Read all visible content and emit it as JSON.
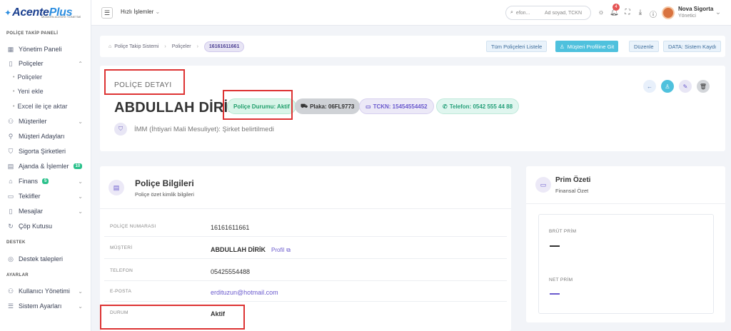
{
  "app": {
    "logo_main": "Acente",
    "logo_accent": "Plus",
    "logo_sub": "MODERN ACENTE YÖNETİMİ"
  },
  "sidebar": {
    "section_main": "POLİÇE TAKİP PANELİ",
    "items": [
      {
        "label": "Yönetim Paneli",
        "icon": "grid-icon"
      },
      {
        "label": "Poliçeler",
        "icon": "document-icon"
      },
      {
        "label": "Poliçeler",
        "icon": "dot"
      },
      {
        "label": "Yeni ekle",
        "icon": "dot"
      },
      {
        "label": "Excel ile içe aktar",
        "icon": "dot"
      },
      {
        "label": "Müşteriler",
        "icon": "users-icon"
      },
      {
        "label": "Müşteri Adayları",
        "icon": "user-plus-icon"
      },
      {
        "label": "Sigorta Şirketleri",
        "icon": "shield-icon"
      },
      {
        "label": "Ajanda & İşlemler",
        "icon": "calendar-icon",
        "badge": "10"
      },
      {
        "label": "Finans",
        "icon": "bank-icon",
        "badge": "5"
      },
      {
        "label": "Teklifler",
        "icon": "file-icon"
      },
      {
        "label": "Mesajlar",
        "icon": "phone-icon"
      },
      {
        "label": "Çöp Kutusu",
        "icon": "refresh-icon"
      }
    ],
    "section_support": "DESTEK",
    "support_item": "Destek talepleri",
    "section_settings": "AYARLAR",
    "settings_items": [
      "Kullanıcı Yönetimi",
      "Sistem Ayarları"
    ]
  },
  "topbar": {
    "quick": "Hızlı İşlemler",
    "search_placeholder": "efon...",
    "search_placeholder2": "Ad soyad, TCKN",
    "notif_count": "4",
    "user_name": "Nova Sigorta",
    "user_role": "Yönetici"
  },
  "breadcrumb": {
    "home": "Poliçe Takip Sistemi",
    "mid": "Poliçeler",
    "current": "16161611661"
  },
  "actions": {
    "list_all": "Tüm Poliçeleri Listele",
    "customer_profile": "Müşteri Profiline Git",
    "edit": "Düzenle",
    "data_source": "DATA: Sistem Kaydı"
  },
  "policy": {
    "section_label": "POLİÇE DETAYI",
    "customer_name": "ABDULLAH DİRİK",
    "status_chip": "Poliçe Durumu: Aktif",
    "plate_chip": "Plaka: 06FL9773",
    "tckn_chip": "TCKN: 15454554452",
    "phone_chip": "Telefon: 0542 555 44 88",
    "imm": "İMM (İhtiyari Mali Mesuliyet): Şirket belirtilmedi"
  },
  "info": {
    "title": "Poliçe Bilgileri",
    "subtitle": "Poliçe özet kimlik bilgileri",
    "rows": [
      {
        "label": "POLİÇE NUMARASI",
        "value": "16161611661"
      },
      {
        "label": "MÜŞTERİ",
        "value": "ABDULLAH DİRİK",
        "link": "Profil"
      },
      {
        "label": "TELEFON",
        "value": "05425554488"
      },
      {
        "label": "E-POSTA",
        "value": "erdituzun@hotmail.com"
      },
      {
        "label": "DURUM",
        "value": "Aktif"
      }
    ]
  },
  "prim": {
    "title": "Prim Özeti",
    "subtitle": "Finansal Özet",
    "gross_label": "BRÜT PRİM",
    "net_label": "NET PRİM"
  },
  "colors": {
    "accent": "#4fc1dd",
    "purple": "#6a5acd",
    "green": "#2bc18b",
    "highlight": "#dd3333"
  }
}
